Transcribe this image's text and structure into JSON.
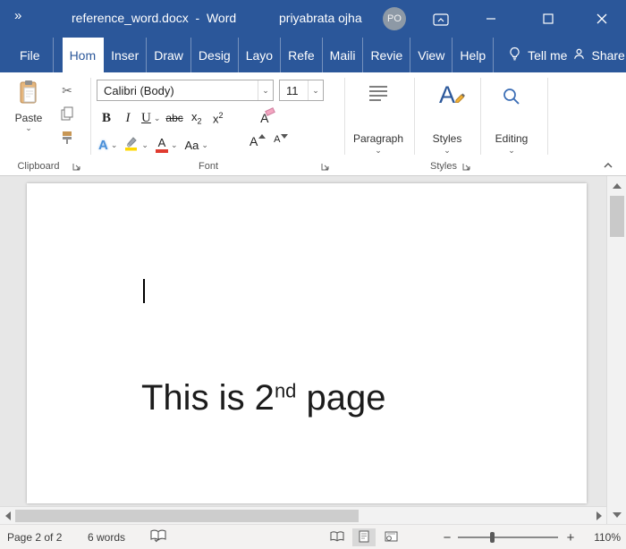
{
  "colors": {
    "title_bar_blue": "#2b579a",
    "active_tab_text": "#2b579a",
    "highlight_yellow": "#ffd800",
    "font_color_red": "#e03b2f",
    "workspace_gray": "#e7e7e7",
    "page_white": "#ffffff"
  },
  "title_bar": {
    "title": "reference_word.docx  -  Word",
    "user_name": "priyabrata ojha",
    "avatar_initials": "PO"
  },
  "ribbon_tabs": {
    "file": "File",
    "items": [
      {
        "label": "Hom",
        "active": true
      },
      {
        "label": "Inser",
        "active": false
      },
      {
        "label": "Draw",
        "active": false
      },
      {
        "label": "Desig",
        "active": false
      },
      {
        "label": "Layo",
        "active": false
      },
      {
        "label": "Refe",
        "active": false
      },
      {
        "label": "Maili",
        "active": false
      },
      {
        "label": "Revie",
        "active": false
      },
      {
        "label": "View",
        "active": false
      },
      {
        "label": "Help",
        "active": false
      }
    ],
    "tell_me": "Tell me",
    "share": "Share"
  },
  "ribbon": {
    "paste_label": "Paste",
    "font_name": "Calibri (Body)",
    "font_size": "11",
    "bold": "B",
    "italic": "I",
    "underline": "U",
    "strikethrough": "abc",
    "subscript": {
      "base": "x",
      "script": "2"
    },
    "superscript": {
      "base": "x",
      "script": "2"
    },
    "clear_formatting": "A",
    "text_effects": "A",
    "font_color_letter": "A",
    "change_case": "Aa",
    "grow_font": "A",
    "shrink_font": "A",
    "paragraph_label": "Paragraph",
    "styles_label": "Styles",
    "editing_label": "Editing",
    "group_clipboard": "Clipboard",
    "group_font": "Font",
    "group_styles": "Styles"
  },
  "document": {
    "text_before": "This is 2",
    "text_superscript": "nd",
    "text_after": " page"
  },
  "status_bar": {
    "page_info": "Page 2 of 2",
    "word_count": "6 words",
    "zoom_level": "110%"
  },
  "icons": {
    "quick_access": "»",
    "dropdown": "⌄",
    "scissors": "✂",
    "zoom_out": "−",
    "zoom_in": "+"
  }
}
